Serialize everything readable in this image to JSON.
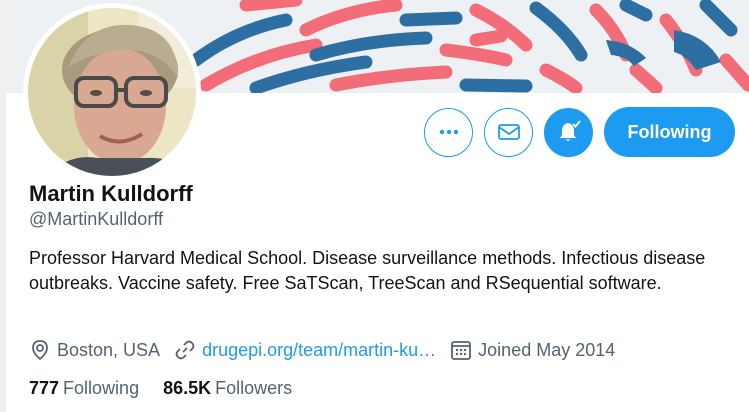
{
  "profile": {
    "name": "Martin Kulldorff",
    "handle": "@MartinKulldorff",
    "bio": "Professor Harvard Medical School. Disease surveillance methods. Infectious disease outbreaks. Vaccine safety. Free SaTScan, TreeScan and RSequential software.",
    "location": "Boston, USA",
    "website": "drugepi.org/team/martin-ku…",
    "joined": "Joined May 2014",
    "following_count": "777",
    "following_label": "Following",
    "followers_count": "86.5K",
    "followers_label": "Followers"
  },
  "actions": {
    "more_icon": "more-icon",
    "message_icon": "envelope-icon",
    "notify_icon": "bell-check-icon",
    "follow_label": "Following"
  },
  "colors": {
    "accent": "#1d9bf0",
    "banner_red": "#f26d78",
    "banner_blue": "#2e6fa3",
    "text": "#0f1419",
    "muted": "#536471"
  }
}
